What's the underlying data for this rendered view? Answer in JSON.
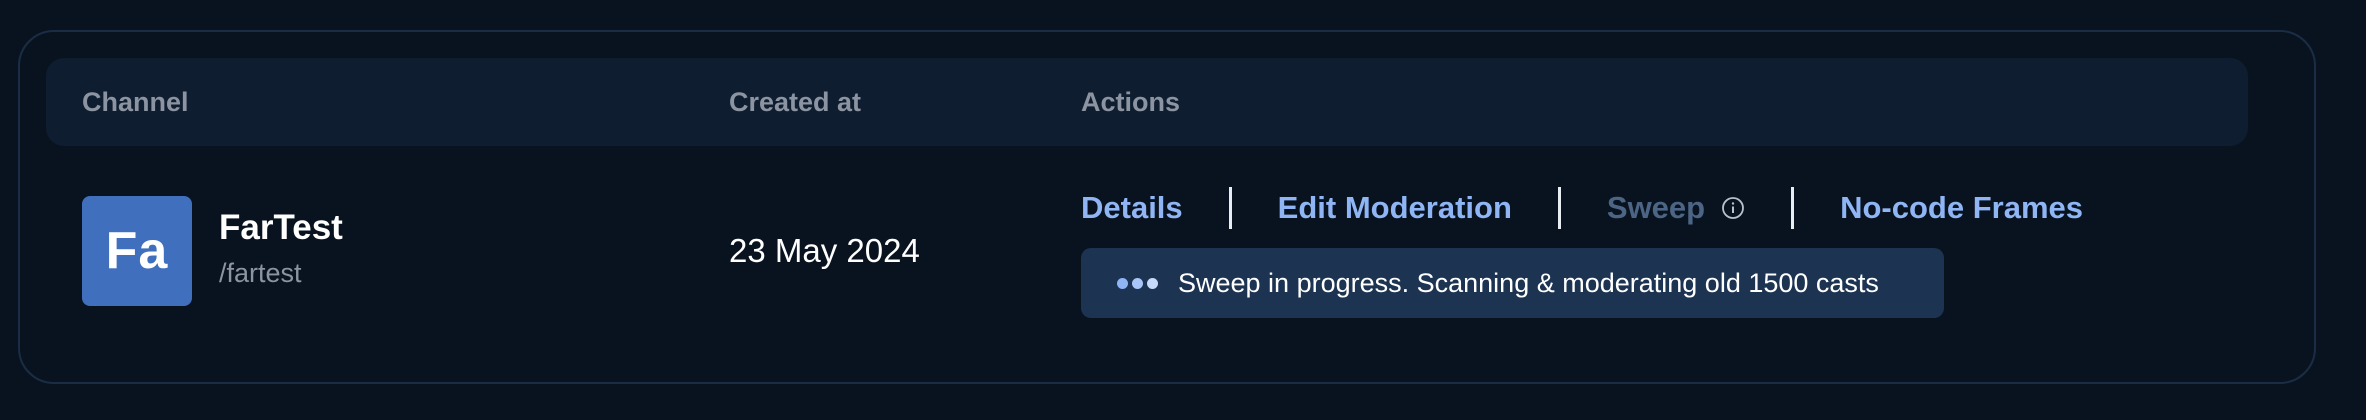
{
  "table": {
    "headers": {
      "channel": "Channel",
      "created_at": "Created at",
      "actions": "Actions"
    }
  },
  "row": {
    "avatar_initials": "Fa",
    "channel_name": "FarTest",
    "channel_handle": "/fartest",
    "created_at": "23 May 2024",
    "actions": {
      "details": "Details",
      "edit_moderation": "Edit Moderation",
      "sweep": "Sweep",
      "no_code_frames": "No-code Frames"
    },
    "sweep_status": "Sweep in progress. Scanning & moderating old 1500 casts"
  },
  "colors": {
    "background": "#09131f",
    "header_bg": "#0f1d30",
    "avatar_bg": "#3f6fbd",
    "link": "#8fb5f5",
    "link_disabled": "#4c6585",
    "status_bg": "#1c3352"
  },
  "icons": {
    "sweep_info": "info-icon",
    "progress": "loading-dots-icon"
  }
}
